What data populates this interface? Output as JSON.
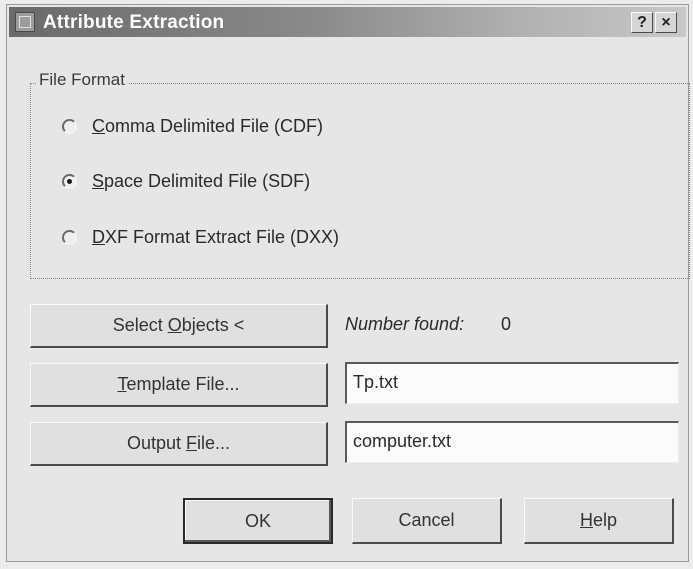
{
  "window": {
    "title": "Attribute Extraction",
    "help_button": "?",
    "close_button": "×",
    "app_icon": "dialog-app-icon"
  },
  "file_format": {
    "group_label": "File Format",
    "options": [
      {
        "mnemonic": "C",
        "rest": "omma Delimited File (CDF)",
        "checked": false
      },
      {
        "mnemonic": "S",
        "rest": "pace Delimited File (SDF)",
        "checked": true
      },
      {
        "mnemonic": "D",
        "rest": "XF Format Extract File (DXX)",
        "checked": false
      }
    ]
  },
  "select_objects": {
    "label_before": "Select ",
    "mnemonic": "O",
    "label_after": "bjects <",
    "number_found_label": "Number found:",
    "number_found_value": "0"
  },
  "template_file": {
    "mnemonic": "T",
    "label_after": "emplate File...",
    "value": "Tp.txt"
  },
  "output_file": {
    "label_before": "Output ",
    "mnemonic": "F",
    "label_after": "ile...",
    "value": "computer.txt"
  },
  "buttons": {
    "ok": "OK",
    "cancel": "Cancel",
    "help_mnemonic": "H",
    "help_rest": "elp"
  },
  "colors": {
    "titlebar_start": "#6a6a6a",
    "titlebar_end": "#c8c8c8",
    "dialog_bg": "#e6e6e6"
  }
}
